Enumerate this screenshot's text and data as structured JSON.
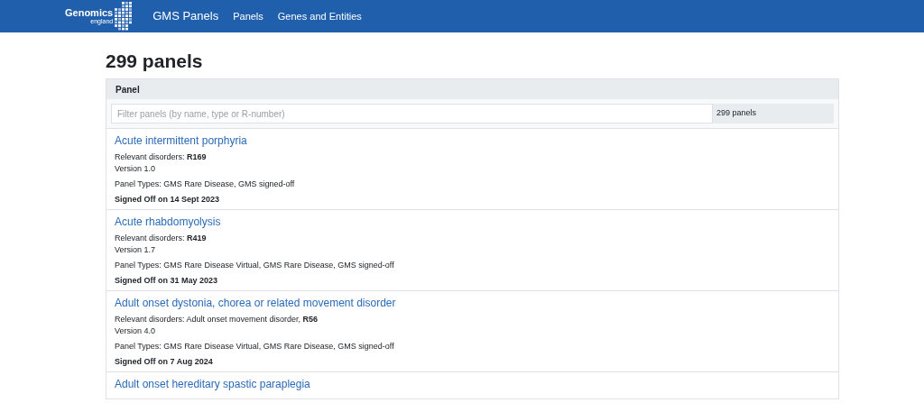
{
  "navbar": {
    "logo": {
      "name": "Genomics",
      "sub": "england"
    },
    "links": [
      "GMS Panels",
      "Panels",
      "Genes and Entities"
    ]
  },
  "title": "299 panels",
  "table": {
    "header": "Panel",
    "filter": {
      "placeholder": "Filter panels (by name, type or R-number)",
      "count": "299 panels"
    },
    "rows": [
      {
        "name": "Acute intermittent porphyria",
        "disorders": "Relevant disorders: **R169**",
        "version": "Version 1.0",
        "types": "Panel Types: GMS Rare Disease, GMS signed-off",
        "signed": "Signed Off on 14 Sept 2023"
      },
      {
        "name": "Acute rhabdomyolysis",
        "disorders": "Relevant disorders: **R419**",
        "version": "Version 1.7",
        "types": "Panel Types: GMS Rare Disease Virtual, GMS Rare Disease, GMS signed-off",
        "signed": "Signed Off on 31 May 2023"
      },
      {
        "name": "Adult onset dystonia, chorea or related movement disorder",
        "disorders": "Relevant disorders: Adult onset movement disorder, **R56**",
        "version": "Version 4.0",
        "types": "Panel Types: GMS Rare Disease Virtual, GMS Rare Disease, GMS signed-off",
        "signed": "Signed Off on 7 Aug 2024"
      },
      {
        "name": "Adult onset hereditary spastic paraplegia"
      }
    ]
  }
}
